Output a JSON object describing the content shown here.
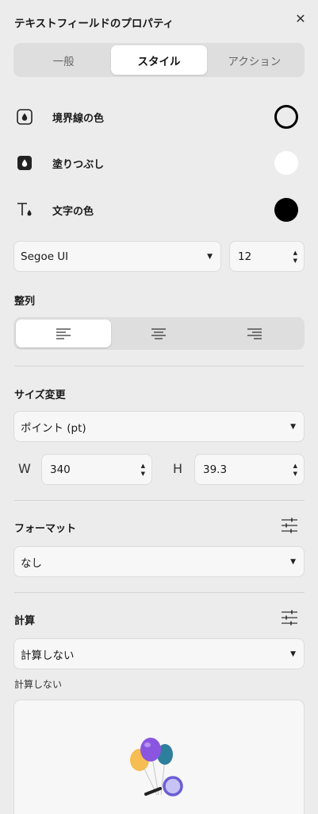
{
  "header": {
    "title": "テキストフィールドのプロパティ",
    "close": "✕"
  },
  "tabs": [
    {
      "label": "一般",
      "active": false
    },
    {
      "label": "スタイル",
      "active": true
    },
    {
      "label": "アクション",
      "active": false
    }
  ],
  "style": {
    "border_color": {
      "label": "境界線の色",
      "value": "#000000",
      "style": "outline"
    },
    "fill_color": {
      "label": "塗りつぶし",
      "value": "#ffffff"
    },
    "text_color": {
      "label": "文字の色",
      "value": "#000000"
    }
  },
  "font": {
    "family": "Segoe UI",
    "size": "12"
  },
  "alignment": {
    "label": "整列",
    "options": [
      "left-align",
      "center-align",
      "right-align"
    ],
    "selected": "left-align"
  },
  "resize": {
    "label": "サイズ変更",
    "unit": "ポイント (pt)",
    "width_label": "W",
    "width": "340",
    "height_label": "H",
    "height": "39.3"
  },
  "format": {
    "label": "フォーマット",
    "value": "なし"
  },
  "calculation": {
    "label": "計算",
    "value": "計算しない",
    "caption": "計算しない"
  }
}
